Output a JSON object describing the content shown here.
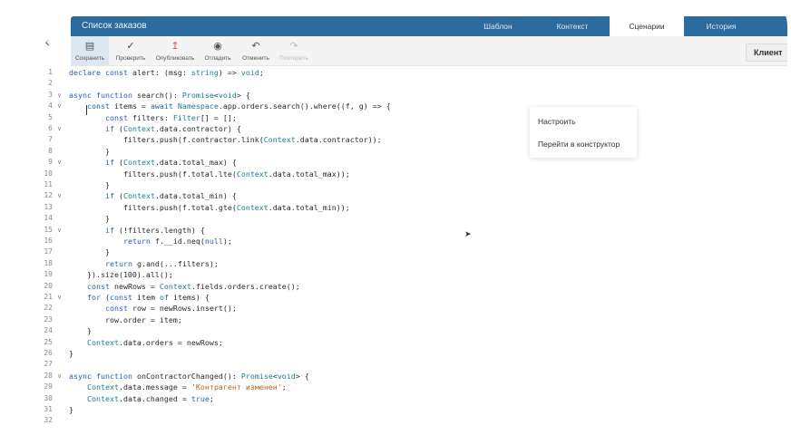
{
  "header": {
    "title": "Список заказов",
    "tabs": [
      {
        "label": "Шаблон",
        "active": false
      },
      {
        "label": "Контекст",
        "active": false
      },
      {
        "label": "Сценарии",
        "active": true
      },
      {
        "label": "История",
        "active": false
      }
    ]
  },
  "back_icon": "chevron-left-icon",
  "toolbar": {
    "save": {
      "label": "Сохранить",
      "icon": "save-icon"
    },
    "check": {
      "label": "Проверить",
      "icon": "check-icon"
    },
    "publish": {
      "label": "Опубликовать",
      "icon": "upload-icon"
    },
    "debug": {
      "label": "Отладить",
      "icon": "record-icon"
    },
    "undo": {
      "label": "Отменить",
      "icon": "undo-icon"
    },
    "redo": {
      "label": "Повторить",
      "icon": "redo-icon"
    },
    "client_label": "Клиент"
  },
  "context_menu": {
    "items": [
      "Настроить",
      "Перейти в конструктор"
    ]
  },
  "code": {
    "lines": [
      {
        "n": "1",
        "fold": false,
        "text": "declare const alert: (msg: string) => void;"
      },
      {
        "n": "2",
        "fold": false,
        "text": ""
      },
      {
        "n": "3",
        "fold": true,
        "text": "async function search(): Promise<void> {"
      },
      {
        "n": "4",
        "fold": true,
        "text": "    const items = await Namespace.app.orders.search().where((f, g) => {"
      },
      {
        "n": "5",
        "fold": false,
        "text": "        const filters: Filter[] = [];"
      },
      {
        "n": "6",
        "fold": true,
        "text": "        if (Context.data.contractor) {"
      },
      {
        "n": "7",
        "fold": false,
        "text": "            filters.push(f.contractor.link(Context.data.contractor));"
      },
      {
        "n": "8",
        "fold": false,
        "text": "        }"
      },
      {
        "n": "9",
        "fold": true,
        "text": "        if (Context.data.total_max) {"
      },
      {
        "n": "10",
        "fold": false,
        "text": "            filters.push(f.total.lte(Context.data.total_max));"
      },
      {
        "n": "11",
        "fold": false,
        "text": "        }"
      },
      {
        "n": "12",
        "fold": true,
        "text": "        if (Context.data.total_min) {"
      },
      {
        "n": "13",
        "fold": false,
        "text": "            filters.push(f.total.gte(Context.data.total_min));"
      },
      {
        "n": "14",
        "fold": false,
        "text": "        }"
      },
      {
        "n": "15",
        "fold": true,
        "text": "        if (!filters.length) {"
      },
      {
        "n": "16",
        "fold": false,
        "text": "            return f.__id.neq(null);"
      },
      {
        "n": "17",
        "fold": false,
        "text": "        }"
      },
      {
        "n": "18",
        "fold": false,
        "text": "        return g.and(...filters);"
      },
      {
        "n": "19",
        "fold": false,
        "text": "    }).size(100).all();"
      },
      {
        "n": "20",
        "fold": false,
        "text": "    const newRows = Context.fields.orders.create();"
      },
      {
        "n": "21",
        "fold": true,
        "text": "    for (const item of items) {"
      },
      {
        "n": "22",
        "fold": false,
        "text": "        const row = newRows.insert();"
      },
      {
        "n": "23",
        "fold": false,
        "text": "        row.order = item;"
      },
      {
        "n": "24",
        "fold": false,
        "text": "    }"
      },
      {
        "n": "25",
        "fold": false,
        "text": "    Context.data.orders = newRows;"
      },
      {
        "n": "26",
        "fold": false,
        "text": "}"
      },
      {
        "n": "27",
        "fold": false,
        "text": ""
      },
      {
        "n": "28",
        "fold": true,
        "text": "async function onContractorChanged(): Promise<void> {"
      },
      {
        "n": "29",
        "fold": false,
        "text": "    Context.data.message = 'Контрагент изменен';"
      },
      {
        "n": "30",
        "fold": false,
        "text": "    Context.data.changed = true;"
      },
      {
        "n": "31",
        "fold": false,
        "text": "}"
      },
      {
        "n": "32",
        "fold": false,
        "text": ""
      }
    ]
  },
  "colors": {
    "header_bg": "#2c6b9e",
    "keyword": "#2b5fb4",
    "type": "#1f7a8c",
    "string": "#b5651d",
    "accent": "#3a7db6"
  }
}
